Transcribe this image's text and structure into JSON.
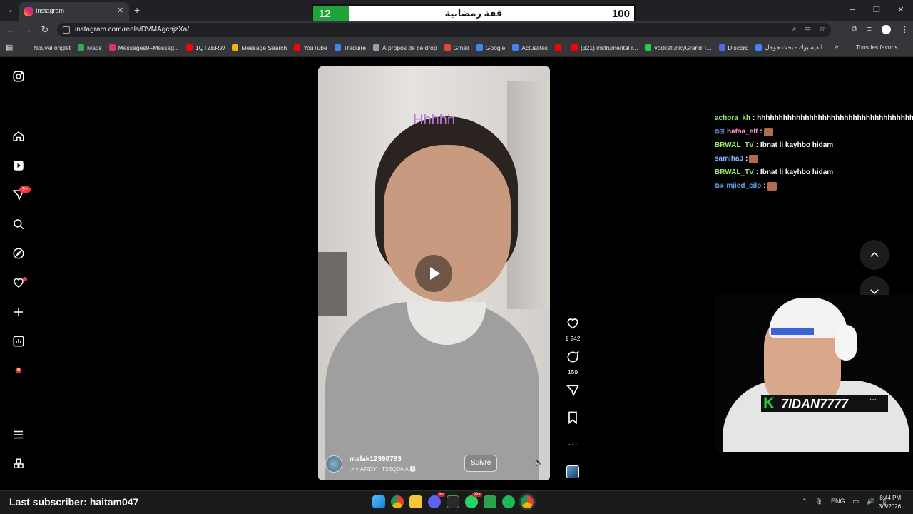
{
  "browser": {
    "tab_title": "Instagram",
    "url": "instagram.com/reels/DVMAgchjzXa/",
    "bookmarks": [
      {
        "label": "Nouvel onglet",
        "color": "#35363a"
      },
      {
        "label": "Maps",
        "color": "#34a853"
      },
      {
        "label": "Messages9+Messag...",
        "color": "#e1306c"
      },
      {
        "label": "1QTZERW",
        "color": "#ff0000"
      },
      {
        "label": "Message Search",
        "color": "#f4b400"
      },
      {
        "label": "YouTube",
        "color": "#ff0000"
      },
      {
        "label": "Traduire",
        "color": "#4285f4"
      },
      {
        "label": "À propos de ce drop",
        "color": "#9aa0a6"
      },
      {
        "label": "Gmail",
        "color": "#ea4335"
      },
      {
        "label": "Google",
        "color": "#4285f4"
      },
      {
        "label": "Actualités",
        "color": "#4285f4"
      },
      {
        "label": "",
        "color": "#ff0000"
      },
      {
        "label": "(321) instrumental r...",
        "color": "#ff0000"
      },
      {
        "label": "vodkafunkyGrand T...",
        "color": "#22d13b"
      },
      {
        "label": "Discord",
        "color": "#5865f2"
      },
      {
        "label": "الفيسبوك - بحث جوجل",
        "color": "#4285f4"
      }
    ],
    "all_bookmarks": "Tous les favoris"
  },
  "overlay": {
    "left_value": "12",
    "title": "قفة رمضانية",
    "right_value": "100"
  },
  "reel": {
    "caption_text": "Hhhhh",
    "username": "malak12398783",
    "audio": "↗ HAFIDY · T3EQDNA 🅴",
    "follow_label": "Suivre",
    "likes": "1 242",
    "comments": "159"
  },
  "sidebar": {
    "notifications_badge": "9+"
  },
  "chat": [
    {
      "badges": "",
      "name": "achora_kh",
      "color": "#9be86a",
      "msg": ": hhhhhhhhhhhhhhhhhhhhhhhhhhhhhhhhhhhhhhhh",
      "emote": false
    },
    {
      "badges": "⧉⊞",
      "name": "hafsa_elf",
      "color": "#ff8fc8",
      "msg": ":",
      "emote": true
    },
    {
      "badges": "",
      "name": "BRWAL_TV",
      "color": "#9be86a",
      "msg": ": Ibnat li kayhbo hidam",
      "emote": false
    },
    {
      "badges": "",
      "name": "samiha3",
      "color": "#8fb3ff",
      "msg": ":",
      "emote": true
    },
    {
      "badges": "",
      "name": "BRWAL_TV",
      "color": "#9be86a",
      "msg": ": Ibnat li kayhbo hidam",
      "emote": false
    },
    {
      "badges": "⧉◈",
      "name": "mjied_cilp",
      "color": "#5ea0e6",
      "msg": ":",
      "emote": true
    }
  ],
  "stream": {
    "cam_name": "7IDAN7777",
    "last_subscriber": "Last subscriber: haitam047"
  },
  "taskbar": {
    "whatsapp_badge": "99+",
    "discord_badge": "9+",
    "lang": "ENG",
    "time": "8:44 PM",
    "date": "3/3/2026"
  }
}
